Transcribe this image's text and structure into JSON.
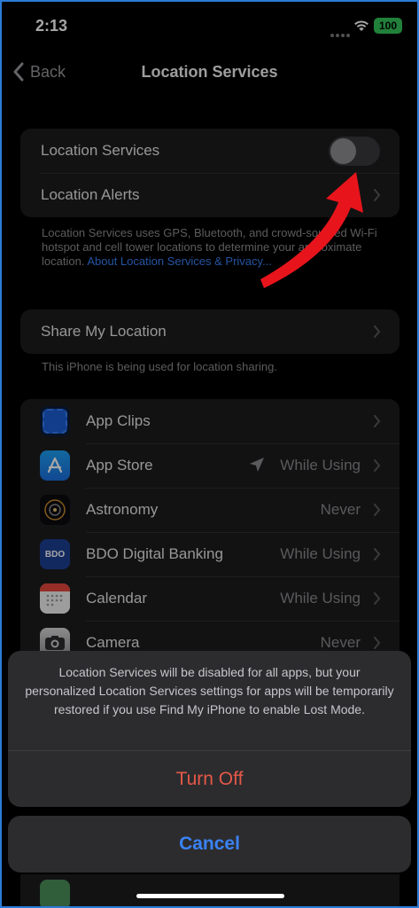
{
  "status": {
    "time": "2:13",
    "battery": "100"
  },
  "nav": {
    "back_label": "Back",
    "title": "Location Services"
  },
  "location_group": {
    "location_services_label": "Location Services",
    "location_services_on": false,
    "location_alerts_label": "Location Alerts"
  },
  "location_footnote": {
    "text": "Location Services uses GPS, Bluetooth, and crowd-sourced Wi-Fi hotspot and cell tower locations to determine your approximate location.",
    "link": "About Location Services & Privacy..."
  },
  "share": {
    "label": "Share My Location",
    "footnote": "This iPhone is being used for location sharing."
  },
  "apps": [
    {
      "name": "App Clips",
      "value": "",
      "icon": "app-clips-icon"
    },
    {
      "name": "App Store",
      "value": "While Using",
      "icon": "app-store-icon",
      "location_arrow": true
    },
    {
      "name": "Astronomy",
      "value": "Never",
      "icon": "astronomy-icon"
    },
    {
      "name": "BDO Digital Banking",
      "value": "While Using",
      "icon": "bdo-icon"
    },
    {
      "name": "Calendar",
      "value": "While Using",
      "icon": "calendar-icon"
    },
    {
      "name": "Camera",
      "value": "Never",
      "icon": "camera-icon"
    }
  ],
  "alert": {
    "message": "Location Services will be disabled for all apps, but your personalized Location Services settings for apps will be temporarily restored if you use Find My iPhone to enable Lost Mode.",
    "turn_off": "Turn Off",
    "cancel": "Cancel"
  },
  "colors": {
    "link": "#3a82f7",
    "destructive": "#e55848",
    "annotation_arrow": "#e8141c"
  }
}
